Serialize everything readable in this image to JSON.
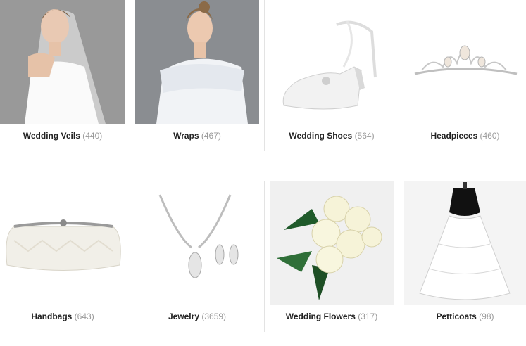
{
  "categories": [
    {
      "label": "Wedding Veils",
      "count": "(440)",
      "image": "bride-with-veil-photo"
    },
    {
      "label": "Wraps",
      "count": "(467)",
      "image": "woman-in-white-wrap-photo"
    },
    {
      "label": "Wedding Shoes",
      "count": "(564)",
      "image": "white-satin-heel-photo"
    },
    {
      "label": "Headpieces",
      "count": "(460)",
      "image": "pearl-tiara-photo"
    },
    {
      "label": "Handbags",
      "count": "(643)",
      "image": "ivory-clutch-photo"
    },
    {
      "label": "Jewelry",
      "count": "(3659)",
      "image": "necklace-earrings-set-photo"
    },
    {
      "label": "Wedding Flowers",
      "count": "(317)",
      "image": "white-rose-bouquet-photo"
    },
    {
      "label": "Petticoats",
      "count": "(98)",
      "image": "hoop-petticoat-photo"
    }
  ],
  "colors": {
    "label": "#222222",
    "count": "#999999",
    "divider": "#dddddd"
  }
}
